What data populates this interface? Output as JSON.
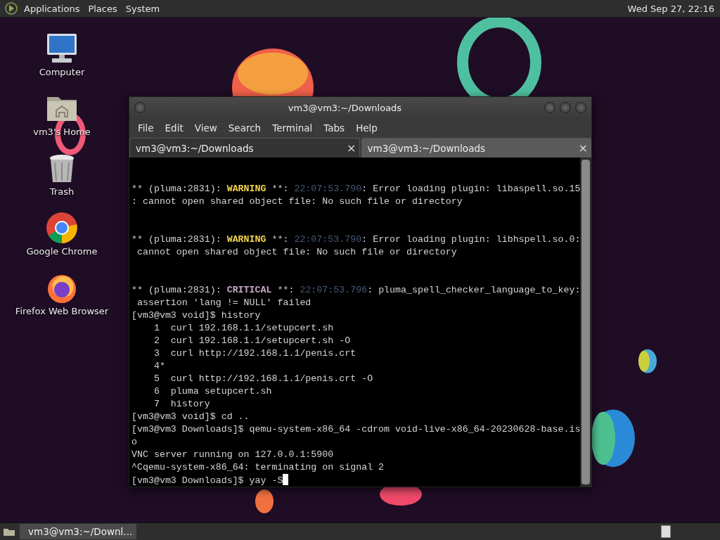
{
  "top_panel": {
    "menus": [
      "Applications",
      "Places",
      "System"
    ],
    "clock": "Wed Sep 27, 22:16"
  },
  "desktop_icons": [
    {
      "label": "Computer",
      "kind": "computer"
    },
    {
      "label": "vm3's Home",
      "kind": "home"
    },
    {
      "label": "Trash",
      "kind": "trash"
    },
    {
      "label": "Google Chrome",
      "kind": "chrome"
    },
    {
      "label": "Firefox Web Browser",
      "kind": "firefox"
    }
  ],
  "window": {
    "title": "vm3@vm3:~/Downloads",
    "menu": [
      "File",
      "Edit",
      "View",
      "Search",
      "Terminal",
      "Tabs",
      "Help"
    ],
    "tabs": [
      {
        "label": "vm3@vm3:~/Downloads",
        "close": "×",
        "selected": true
      },
      {
        "label": "vm3@vm3:~/Downloads",
        "close": "×",
        "selected": false
      }
    ],
    "terminal": {
      "cursor_visible": true,
      "blocks": [
        {
          "lines": [
            {
              "segments": [
                {
                  "text": "** (pluma:2831): ",
                  "kind": "plain"
                },
                {
                  "text": "WARNING",
                  "kind": "warning"
                },
                {
                  "text": " **: ",
                  "kind": "plain"
                },
                {
                  "text": "22:07:53.790",
                  "kind": "time"
                },
                {
                  "text": ": Error loading plugin: libaspell.so.15",
                  "kind": "plain"
                }
              ]
            },
            {
              "segments": [
                {
                  "text": ": cannot open shared object file: No such file or directory",
                  "kind": "plain"
                }
              ]
            }
          ]
        },
        {
          "lines": [
            {
              "segments": [
                {
                  "text": "** (pluma:2831): ",
                  "kind": "plain"
                },
                {
                  "text": "WARNING",
                  "kind": "warning"
                },
                {
                  "text": " **: ",
                  "kind": "plain"
                },
                {
                  "text": "22:07:53.790",
                  "kind": "time"
                },
                {
                  "text": ": Error loading plugin: libhspell.so.0:",
                  "kind": "plain"
                }
              ]
            },
            {
              "segments": [
                {
                  "text": " cannot open shared object file: No such file or directory",
                  "kind": "plain"
                }
              ]
            }
          ]
        },
        {
          "lines": [
            {
              "segments": [
                {
                  "text": "** (pluma:2831): ",
                  "kind": "plain"
                },
                {
                  "text": "CRITICAL",
                  "kind": "critical"
                },
                {
                  "text": " **: ",
                  "kind": "plain"
                },
                {
                  "text": "22:07:53.796",
                  "kind": "time"
                },
                {
                  "text": ": pluma_spell_checker_language_to_key:",
                  "kind": "plain"
                }
              ]
            },
            {
              "segments": [
                {
                  "text": " assertion 'lang != NULL' failed",
                  "kind": "plain"
                }
              ]
            },
            {
              "segments": [
                {
                  "text": "[vm3@vm3 void]$ history",
                  "kind": "plain"
                }
              ]
            },
            {
              "segments": [
                {
                  "text": "    1  curl 192.168.1.1/setupcert.sh",
                  "kind": "plain"
                }
              ]
            },
            {
              "segments": [
                {
                  "text": "    2  curl 192.168.1.1/setupcert.sh -O",
                  "kind": "plain"
                }
              ]
            },
            {
              "segments": [
                {
                  "text": "    3  curl http://192.168.1.1/penis.crt",
                  "kind": "plain"
                }
              ]
            },
            {
              "segments": [
                {
                  "text": "    4*",
                  "kind": "plain"
                }
              ]
            },
            {
              "segments": [
                {
                  "text": "    5  curl http://192.168.1.1/penis.crt -O",
                  "kind": "plain"
                }
              ]
            },
            {
              "segments": [
                {
                  "text": "    6  pluma setupcert.sh",
                  "kind": "plain"
                }
              ]
            },
            {
              "segments": [
                {
                  "text": "    7  history",
                  "kind": "plain"
                }
              ]
            },
            {
              "segments": [
                {
                  "text": "[vm3@vm3 void]$ cd ..",
                  "kind": "plain"
                }
              ]
            },
            {
              "segments": [
                {
                  "text": "[vm3@vm3 Downloads]$ qemu-system-x86_64 -cdrom void-live-x86_64-20230628-base.is",
                  "kind": "plain"
                }
              ]
            },
            {
              "segments": [
                {
                  "text": "o",
                  "kind": "plain"
                }
              ]
            },
            {
              "segments": [
                {
                  "text": "VNC server running on 127.0.0.1:5900",
                  "kind": "plain"
                }
              ]
            },
            {
              "segments": [
                {
                  "text": "^Cqemu-system-x86_64: terminating on signal 2",
                  "kind": "plain"
                }
              ]
            },
            {
              "segments": [
                {
                  "text": "[vm3@vm3 Downloads]$ yay -S",
                  "kind": "plain"
                }
              ]
            }
          ]
        }
      ]
    }
  },
  "taskbar": {
    "buttons": [
      {
        "label": "vm3@vm3:~/Downl...",
        "selected": false
      }
    ]
  }
}
